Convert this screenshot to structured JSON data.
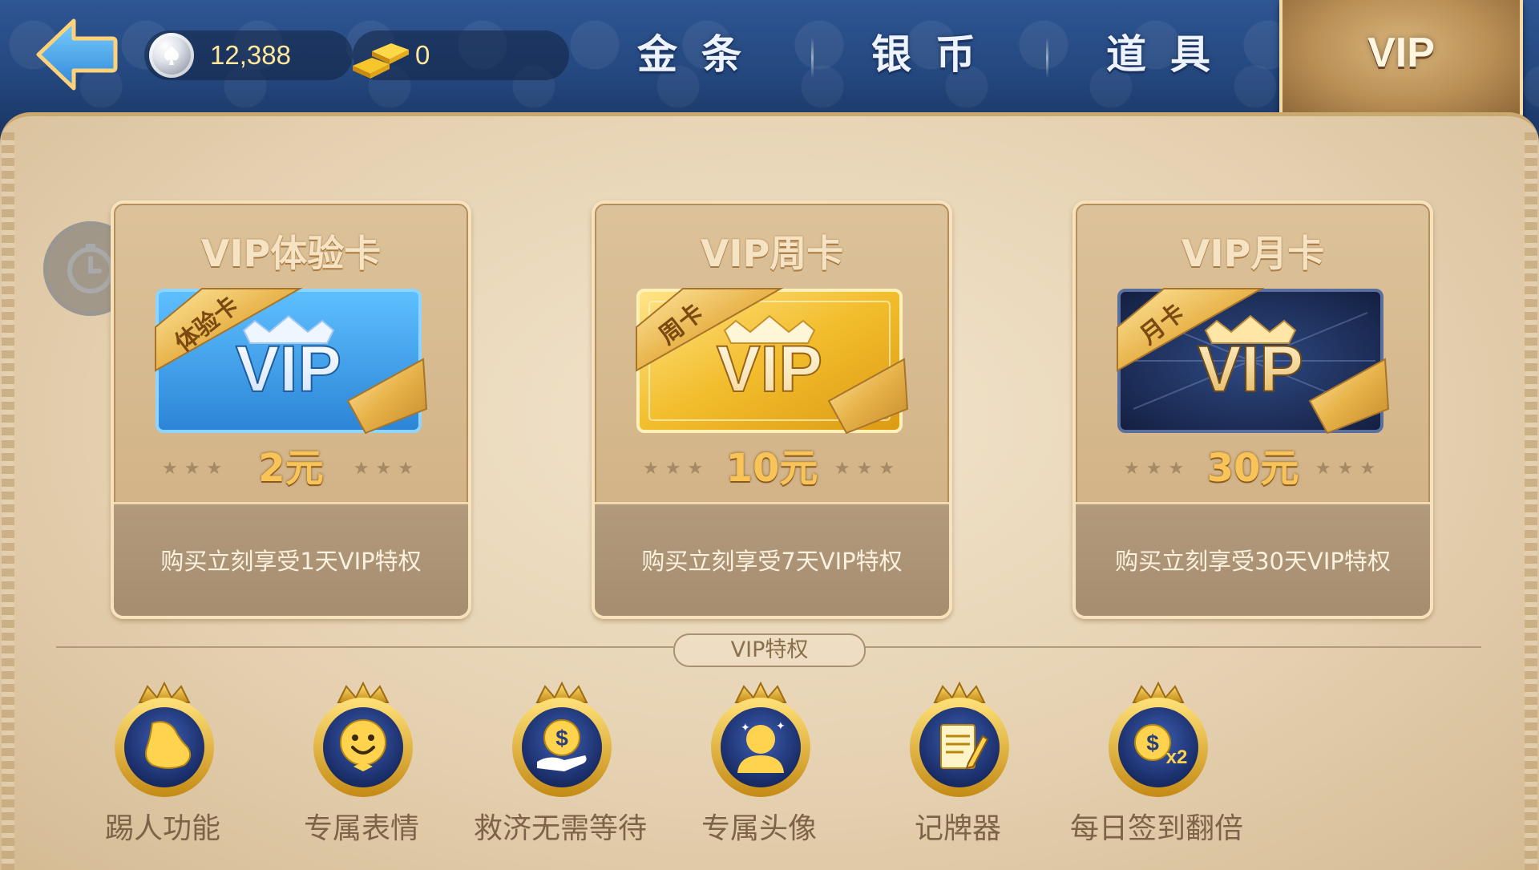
{
  "header": {
    "back_icon": "back-arrow-icon",
    "silver_coin": {
      "icon": "silver-coin-icon",
      "value": "12,388"
    },
    "gold_bar": {
      "icon": "gold-bar-icon",
      "value": "0"
    },
    "tabs": [
      {
        "label": "金条",
        "active": false
      },
      {
        "label": "银币",
        "active": false
      },
      {
        "label": "道具",
        "active": false
      },
      {
        "label": "VIP",
        "active": true
      }
    ]
  },
  "side": {
    "clock_icon": "clock-icon"
  },
  "cards": [
    {
      "title": "VIP体验卡",
      "ribbon": "体验卡",
      "badge": "VIP",
      "price": "2元",
      "description": "购买立刻享受1天VIP特权",
      "theme": "blue"
    },
    {
      "title": "VIP周卡",
      "ribbon": "周卡",
      "badge": "VIP",
      "price": "10元",
      "description": "购买立刻享受7天VIP特权",
      "theme": "gold"
    },
    {
      "title": "VIP月卡",
      "ribbon": "月卡",
      "badge": "VIP",
      "price": "30元",
      "description": "购买立刻享受30天VIP特权",
      "theme": "navy"
    }
  ],
  "privileges": {
    "title": "VIP特权",
    "items": [
      {
        "label": "踢人功能",
        "icon": "kick-shoe-icon"
      },
      {
        "label": "专属表情",
        "icon": "smiley-face-icon"
      },
      {
        "label": "救济无需等待",
        "icon": "coin-hand-icon"
      },
      {
        "label": "专属头像",
        "icon": "avatar-icon"
      },
      {
        "label": "记牌器",
        "icon": "notepad-pencil-icon"
      },
      {
        "label": "每日签到翻倍",
        "icon": "double-coin-icon"
      }
    ]
  },
  "colors": {
    "header_blue": "#24487f",
    "panel_beige": "#e6d2b2",
    "price_gold": "#f8c458",
    "card_blue": "#3a9be0",
    "card_gold": "#f2c23d",
    "card_navy": "#1c2a52"
  }
}
